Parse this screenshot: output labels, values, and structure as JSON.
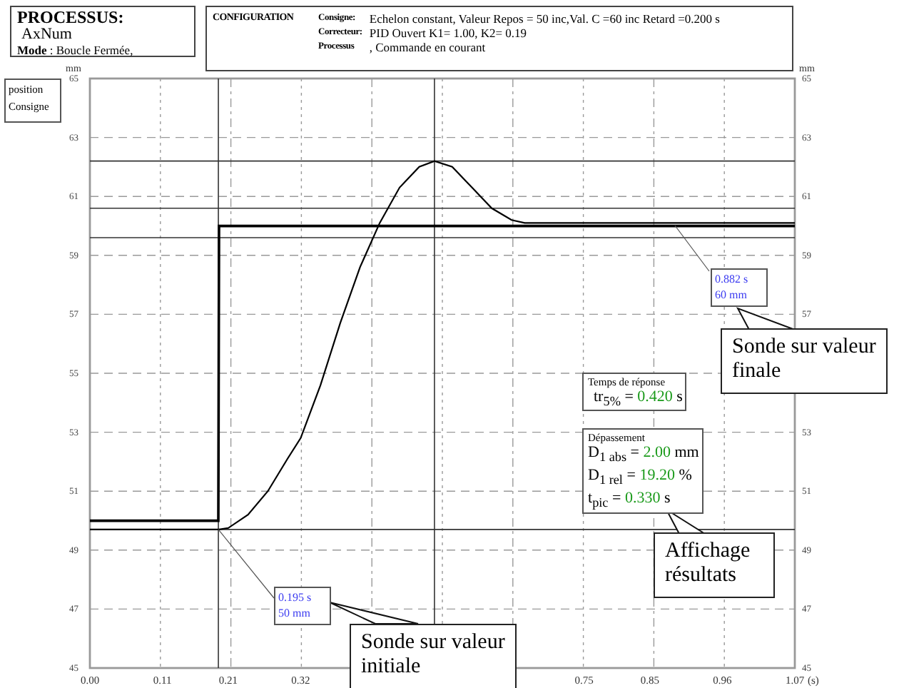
{
  "process": {
    "title": "PROCESSUS:",
    "name": "AxNum",
    "mode": "**Mode** : Boucle Fermée,"
  },
  "configuration": {
    "title": "CONFIGURATION",
    "rows": [
      {
        "label": "Consigne:",
        "value": "Echelon constant, Valeur Repos = 50 inc,Val. C =60 inc Retard =0.200 s"
      },
      {
        "label": "Correcteur:",
        "value": "PID Ouvert K1= 1.00, K2= 0.19"
      },
      {
        "label": "Processus",
        "value": ", Commande en courant"
      }
    ]
  },
  "plot": {
    "unit_right": "mm",
    "right_axis_ticks": [
      "65",
      "63",
      "61",
      "59",
      "57",
      "53",
      "51",
      "49",
      "47",
      "45"
    ],
    "chart_data": {
      "type": "line",
      "xlabel": "(s)",
      "ylabel": "mm",
      "x": [
        0,
        0.1,
        0.19,
        0.195,
        0.196,
        0.21,
        0.24,
        0.27,
        0.3,
        0.32,
        0.35,
        0.38,
        0.41,
        0.44,
        0.47,
        0.5,
        0.523,
        0.55,
        0.58,
        0.61,
        0.64,
        0.66,
        0.8,
        1.0,
        1.07
      ],
      "series": [
        {
          "name": "position",
          "color": "#000000",
          "values": [
            49.7,
            49.7,
            49.7,
            49.7,
            49.7,
            49.75,
            50.2,
            51.0,
            52.1,
            52.8,
            54.6,
            56.7,
            58.6,
            60.1,
            61.3,
            62.0,
            62.2,
            62.0,
            61.3,
            60.6,
            60.2,
            60.1,
            60.1,
            60.1,
            60.1
          ]
        },
        {
          "name": "Consigne",
          "color": "#000000",
          "values": [
            50,
            50,
            50,
            50,
            60,
            60,
            60,
            60,
            60,
            60,
            60,
            60,
            60,
            60,
            60,
            60,
            60,
            60,
            60,
            60,
            60,
            60,
            60,
            60,
            60
          ]
        }
      ],
      "xlim": [
        0,
        1.07
      ],
      "ylim": [
        45,
        65
      ],
      "xticks": [
        {
          "value": 0,
          "label": "0.00"
        },
        {
          "value": 0.11,
          "label": "0.11"
        },
        {
          "value": 0.21,
          "label": "0.21"
        },
        {
          "value": 0.32,
          "label": "0.32"
        },
        {
          "value": 0.75,
          "label": "0.75"
        },
        {
          "value": 0.85,
          "label": "0.85"
        },
        {
          "value": 0.96,
          "label": "0.96"
        },
        {
          "value": 1.07,
          "label": "1.07"
        }
      ],
      "yticks": [
        45,
        47,
        49,
        51,
        53,
        55,
        57,
        59,
        61,
        63,
        65
      ],
      "grid": true,
      "ref_lines": [
        {
          "axis": "y",
          "value": 62.2
        },
        {
          "axis": "y",
          "value": 60.6
        },
        {
          "axis": "y",
          "value": 59.6
        },
        {
          "axis": "y",
          "value": 49.7
        },
        {
          "axis": "x",
          "value": 0.195
        },
        {
          "axis": "x",
          "value": 0.523
        }
      ]
    },
    "probes": [
      {
        "time": "0.195 s",
        "value": "50 mm"
      },
      {
        "time": "0.882 s",
        "value": "60 mm"
      }
    ],
    "callouts": [
      "Sonde sur valeur initiale",
      "Sonde sur valeur finale",
      "Affichage résultats"
    ],
    "response_time": {
      "title": "Temps de réponse",
      "label": "tr$_{5%}$ =",
      "value": "0.420",
      "unit": "s"
    },
    "overshoot": {
      "title": "Dépassement",
      "rows": [
        {
          "label": "D$_{1 abs}$ =",
          "value": "2.00",
          "unit": "mm"
        },
        {
          "label": "D$_{1 rel}$ =",
          "value": "19.20",
          "unit": "%"
        },
        {
          "label": "t$_{pic}$ =",
          "value": "0.330",
          "unit": "s"
        }
      ]
    }
  }
}
